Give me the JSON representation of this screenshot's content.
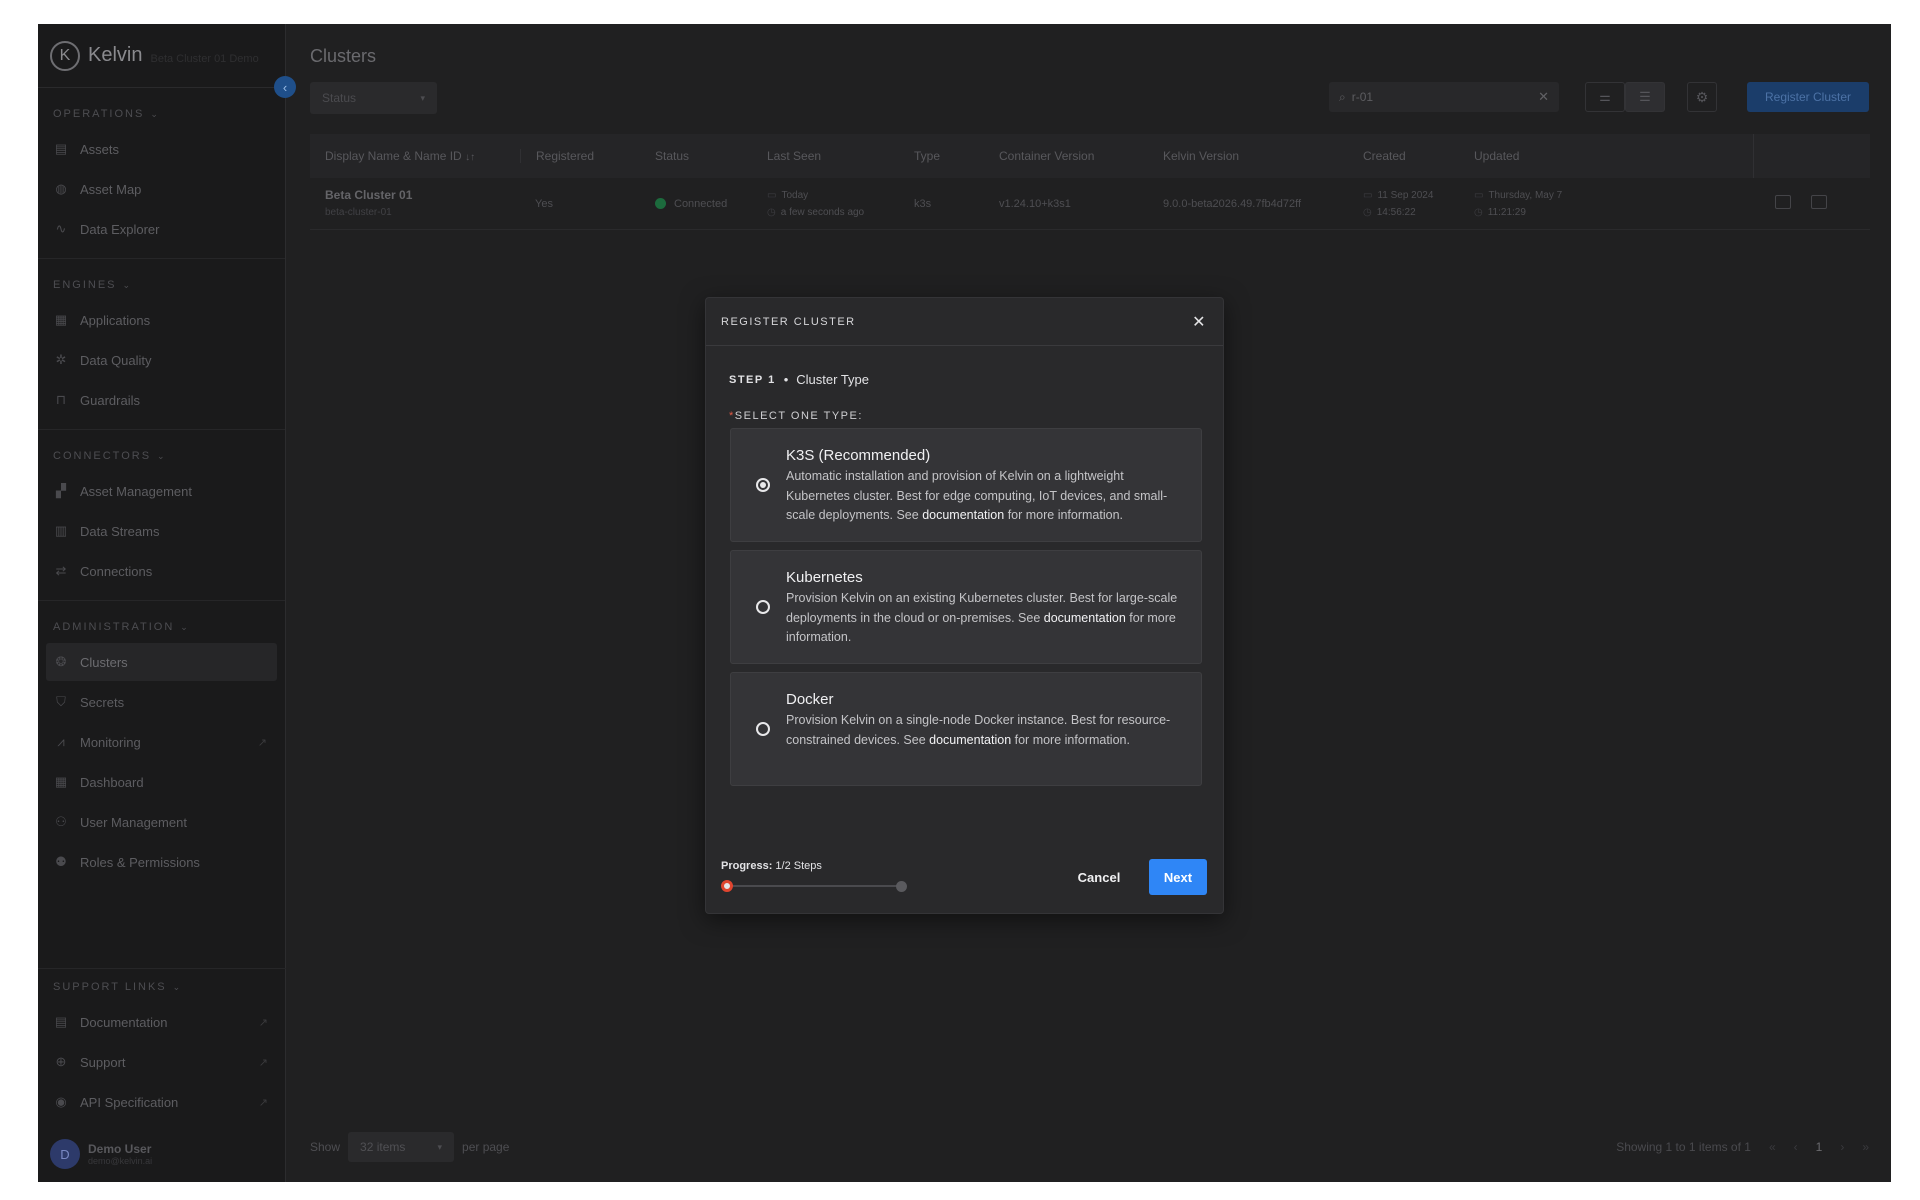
{
  "app": {
    "logo_text": "Kelvin",
    "logo_sub": "Beta Cluster 01 Demo",
    "logo_letter": "K"
  },
  "sidebar": {
    "operations": {
      "title": "OPERATIONS",
      "items": [
        {
          "label": "Assets",
          "icon": "assets-icon"
        },
        {
          "label": "Asset Map",
          "icon": "globe-icon"
        },
        {
          "label": "Data Explorer",
          "icon": "pulse-icon"
        }
      ]
    },
    "engines": {
      "title": "ENGINES",
      "items": [
        {
          "label": "Applications",
          "icon": "grid-icon"
        },
        {
          "label": "Data Quality",
          "icon": "gear-icon"
        },
        {
          "label": "Guardrails",
          "icon": "barrier-icon"
        }
      ]
    },
    "connectors": {
      "title": "CONNECTORS",
      "items": [
        {
          "label": "Asset Management",
          "icon": "asset-mgmt-icon"
        },
        {
          "label": "Data Streams",
          "icon": "bar-chart-icon"
        },
        {
          "label": "Connections",
          "icon": "connections-icon"
        }
      ]
    },
    "administration": {
      "title": "ADMINISTRATION",
      "items": [
        {
          "label": "Clusters",
          "icon": "clusters-icon"
        },
        {
          "label": "Secrets",
          "icon": "shield-icon"
        },
        {
          "label": "Monitoring",
          "icon": "monitoring-icon"
        },
        {
          "label": "Dashboard",
          "icon": "dashboard-icon"
        },
        {
          "label": "User Management",
          "icon": "users-icon"
        },
        {
          "label": "Roles & Permissions",
          "icon": "roles-icon"
        }
      ]
    },
    "support": {
      "title": "SUPPORT LINKS",
      "items": [
        {
          "label": "Documentation",
          "icon": "doc-icon"
        },
        {
          "label": "Support",
          "icon": "lifebuoy-icon"
        },
        {
          "label": "API Specification",
          "icon": "api-icon"
        }
      ]
    },
    "user": {
      "initial": "D",
      "name": "Demo User",
      "email": "demo@kelvin.ai"
    }
  },
  "page": {
    "title": "Clusters"
  },
  "toolbar": {
    "status_filter": "Status",
    "search_value": "r-01",
    "register_label": "Register Cluster"
  },
  "table": {
    "columns": [
      "Display Name & Name ID",
      "Registered",
      "Status",
      "Last Seen",
      "Type",
      "Container Version",
      "Kelvin Version",
      "Created",
      "Updated"
    ],
    "sort_indicator": "↓↑",
    "rows": [
      {
        "name": "Beta Cluster 01",
        "id": "beta-cluster-01",
        "registered": "Yes",
        "status": "Connected",
        "last_seen_day": "Today",
        "last_seen_ago": "a few seconds ago",
        "type": "k3s",
        "container_version": "v1.24.10+k3s1",
        "kelvin_version": "9.0.0-beta2026.49.7fb4d72ff",
        "created_date": "11 Sep 2024",
        "created_time": "14:56:22",
        "updated_date": "Thursday, May 7",
        "updated_time": "11:21:29"
      }
    ]
  },
  "footer": {
    "show": "Show",
    "per_page_value": "32 items",
    "per_page": "per page",
    "showing": "Showing 1 to 1 items of 1",
    "current_page": "1"
  },
  "modal": {
    "title": "REGISTER CLUSTER",
    "step_label": "STEP 1",
    "step_name": "Cluster Type",
    "select_label": "SELECT ONE TYPE:",
    "options": [
      {
        "title": "K3S (Recommended)",
        "desc_pre": "Automatic installation and provision of Kelvin on a lightweight Kubernetes cluster. Best for edge computing, IoT devices, and small-scale deployments. See ",
        "link": "documentation",
        "desc_post": " for more information.",
        "selected": true
      },
      {
        "title": "Kubernetes",
        "desc_pre": "Provision Kelvin on an existing Kubernetes cluster. Best for large-scale deployments in the cloud or on-premises. See ",
        "link": "documentation",
        "desc_post": " for more information.",
        "selected": false
      },
      {
        "title": "Docker",
        "desc_pre": "Provision Kelvin on a single-node Docker instance. Best for resource-constrained devices. See ",
        "link": "documentation",
        "desc_post": " for more information.",
        "selected": false
      }
    ],
    "progress_label": "Progress:",
    "progress_value": "1/2 Steps",
    "progress_fraction": 0.5,
    "cancel_label": "Cancel",
    "next_label": "Next"
  },
  "colors": {
    "accent": "#2f86f6",
    "progress_start": "#e0452f",
    "connected": "#1c6b3d"
  }
}
